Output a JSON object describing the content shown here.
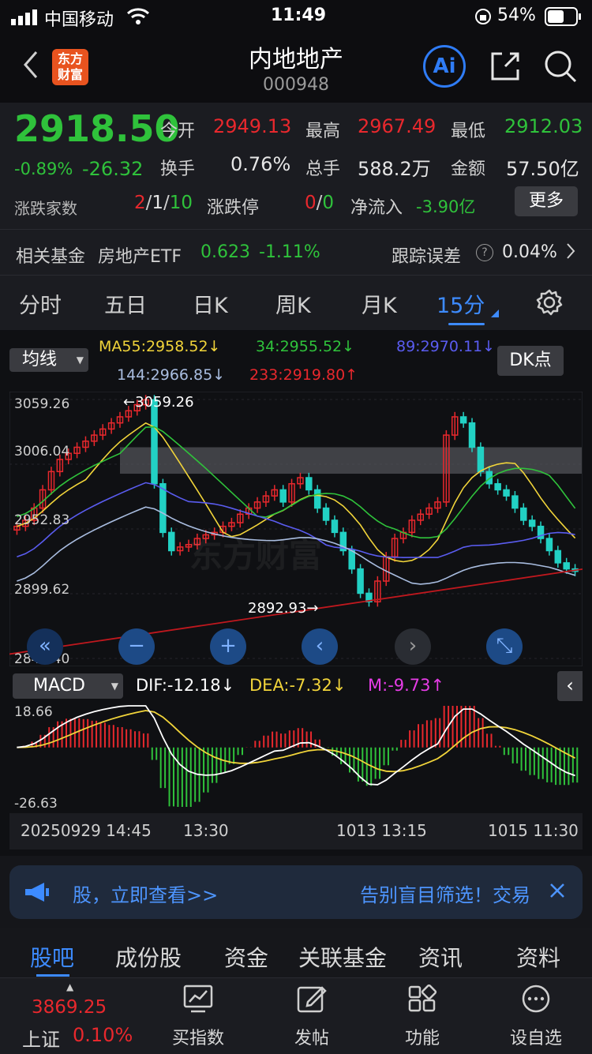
{
  "status_bar": {
    "carrier": "中国移动",
    "time": "11:49",
    "battery": "54%"
  },
  "header": {
    "logo_line1": "东方",
    "logo_line2": "财富",
    "title": "内地地产",
    "code": "000948",
    "ai_label": "Ai"
  },
  "quote": {
    "price": "2918.50",
    "change_pct": "-0.89%",
    "change": "-26.32",
    "open_label": "今开",
    "open": "2949.13",
    "high_label": "最高",
    "high": "2967.49",
    "low_label": "最低",
    "low": "2912.03",
    "turnover_label": "换手",
    "turnover": "0.76%",
    "volume_label": "总手",
    "volume": "588.2万",
    "amount_label": "金额",
    "amount": "57.50亿",
    "advdec_label": "涨跌家数",
    "adv": "2",
    "sep1": "/",
    "flat": "1",
    "sep2": "/",
    "dec": "10",
    "limit_label": "涨跌停",
    "limit_up": "0",
    "sep3": "/",
    "limit_down": "0",
    "netflow_label": "净流入",
    "netflow": "-3.90亿",
    "more_button": "更多",
    "fund_label": "相关基金",
    "fund_name": "房地产ETF",
    "fund_price": "0.623",
    "fund_change": "-1.11%",
    "tracking_label": "跟踪误差",
    "tracking_value": "0.04%"
  },
  "period_tabs": [
    "分时",
    "五日",
    "日K",
    "周K",
    "月K",
    "15分"
  ],
  "active_tab": "15分",
  "chart": {
    "indicator_select": "均线",
    "ma55": "MA55:2958.52↓",
    "ma34": "34:2955.52↓",
    "ma89": "89:2970.11↓",
    "ma144": "144:2966.85↓",
    "ma233": "233:2919.80↑",
    "dk_button": "DK点",
    "y_ticks": [
      "3059.26",
      "3006.04",
      "2952.83",
      "2899.62",
      "2846.40"
    ],
    "max_marker": "←3059.26",
    "min_marker": "2892.93→",
    "watermark": "东方财富",
    "macd_select": "MACD",
    "dif": "DIF:-12.18↓",
    "dea": "DEA:-7.32↓",
    "m": "M:-9.73↑",
    "macd_top": "18.66",
    "macd_bottom": "-26.63",
    "x_labels": [
      "20250929 14:45",
      "13:30",
      "1013 13:15",
      "1015 11:30"
    ],
    "colors": {
      "ma55": "#f1d43a",
      "ma34": "#2fc23b",
      "ma89": "#5a5cf0",
      "ma144": "#a9bde0",
      "ma233": "#c0181e",
      "up": "#e8282d",
      "down": "#22d1c4"
    }
  },
  "chart_data": {
    "type": "candlestick",
    "title": "",
    "y_range": [
      2846.4,
      3059.26
    ],
    "y_ticks": [
      3059.26,
      3006.04,
      2952.83,
      2899.62,
      2846.4
    ],
    "max": 3059.26,
    "min": 2892.93,
    "x_labels": [
      "20250929 14:45",
      "13:30",
      "1013 13:15",
      "1015 11:30"
    ],
    "series": [
      {
        "name": "MA55",
        "last": 2958.52
      },
      {
        "name": "MA34",
        "last": 2955.52
      },
      {
        "name": "MA89",
        "last": 2970.11
      },
      {
        "name": "MA144",
        "last": 2966.85
      },
      {
        "name": "MA233",
        "last": 2919.8
      }
    ],
    "close_approx": [
      2955,
      2960,
      2970,
      2985,
      3000,
      3010,
      3015,
      3020,
      3025,
      3030,
      3035,
      3040,
      3045,
      3050,
      3055,
      3059,
      2990,
      2950,
      2935,
      2938,
      2940,
      2945,
      2948,
      2950,
      2955,
      2958,
      2965,
      2970,
      2975,
      2980,
      2985,
      2975,
      2990,
      2995,
      2985,
      2970,
      2960,
      2950,
      2935,
      2920,
      2900,
      2893,
      2910,
      2930,
      2945,
      2950,
      2960,
      2965,
      2970,
      2975,
      3030,
      3045,
      3040,
      3020,
      3000,
      2990,
      2985,
      2980,
      2970,
      2960,
      2955,
      2945,
      2935,
      2925,
      2920,
      2918
    ],
    "macd": {
      "dif": -12.18,
      "dea": -7.32,
      "m": -9.73,
      "range": [
        -26.63,
        18.66
      ]
    }
  },
  "banner": {
    "text_left": "股，立即查看>>",
    "text_right": "告别盲目筛选！交易"
  },
  "bottom_tabs": [
    "股吧",
    "成份股",
    "资金",
    "关联基金",
    "资讯",
    "资料"
  ],
  "toolbar": {
    "index_value": "3869.25",
    "index_name": "上证",
    "index_change": "0.10%",
    "buy_index": "买指数",
    "post": "发帖",
    "features": "功能",
    "settings": "设自选"
  }
}
